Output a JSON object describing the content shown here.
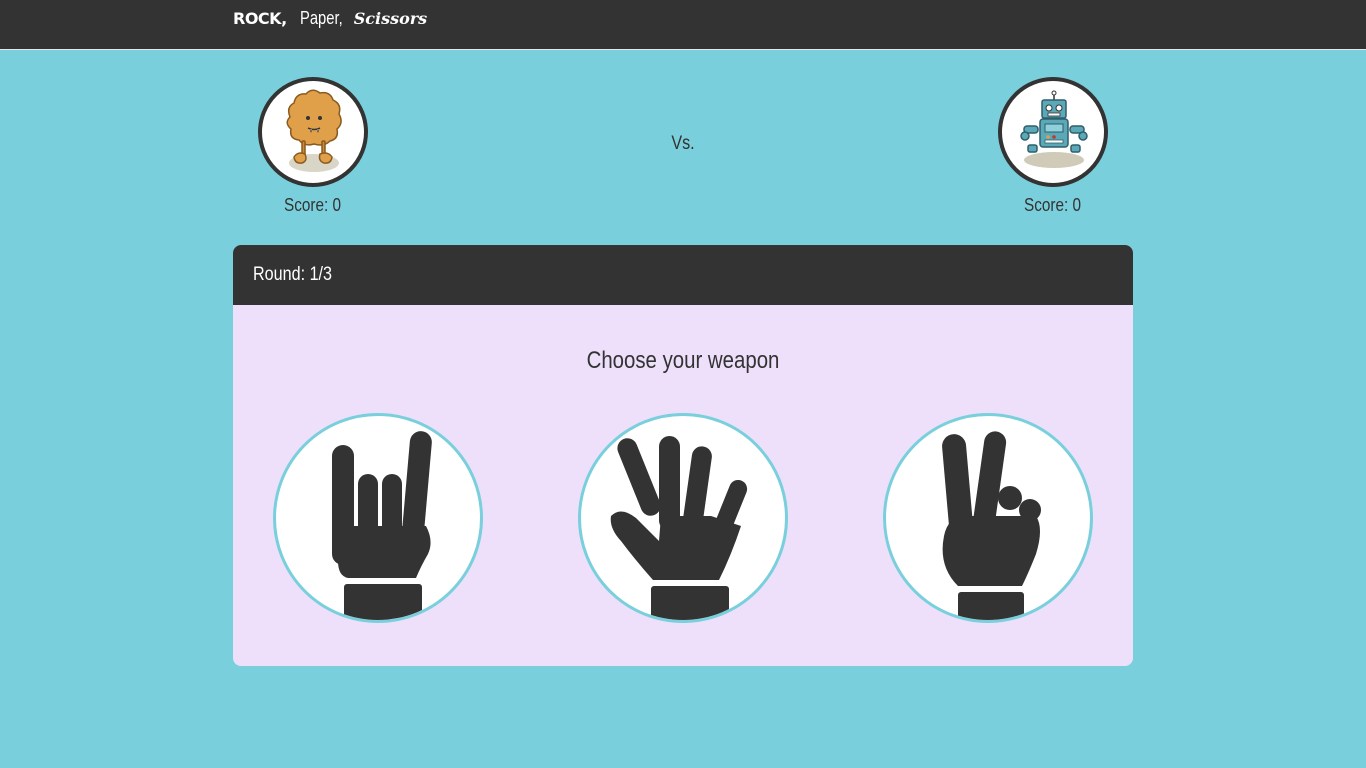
{
  "header": {
    "brand_rock": "ROCK,",
    "brand_paper": "Paper,",
    "brand_scissors": "Scissors"
  },
  "players": {
    "human": {
      "score_label": "Score: 0",
      "avatar_icon": "monster-avatar"
    },
    "robot": {
      "score_label": "Score: 0",
      "avatar_icon": "robot-avatar"
    }
  },
  "vs_label": "Vs.",
  "round": {
    "label": "Round: 1/3"
  },
  "prompt": "Choose your weapon",
  "weapons": [
    {
      "name": "rock",
      "icon": "rock-hand-icon"
    },
    {
      "name": "paper",
      "icon": "paper-hand-icon"
    },
    {
      "name": "scissors",
      "icon": "scissors-hand-icon"
    }
  ],
  "colors": {
    "background": "#79d0dc",
    "dark": "#333333",
    "panel": "#eee0fb",
    "accent_ring": "#79d0dc"
  }
}
